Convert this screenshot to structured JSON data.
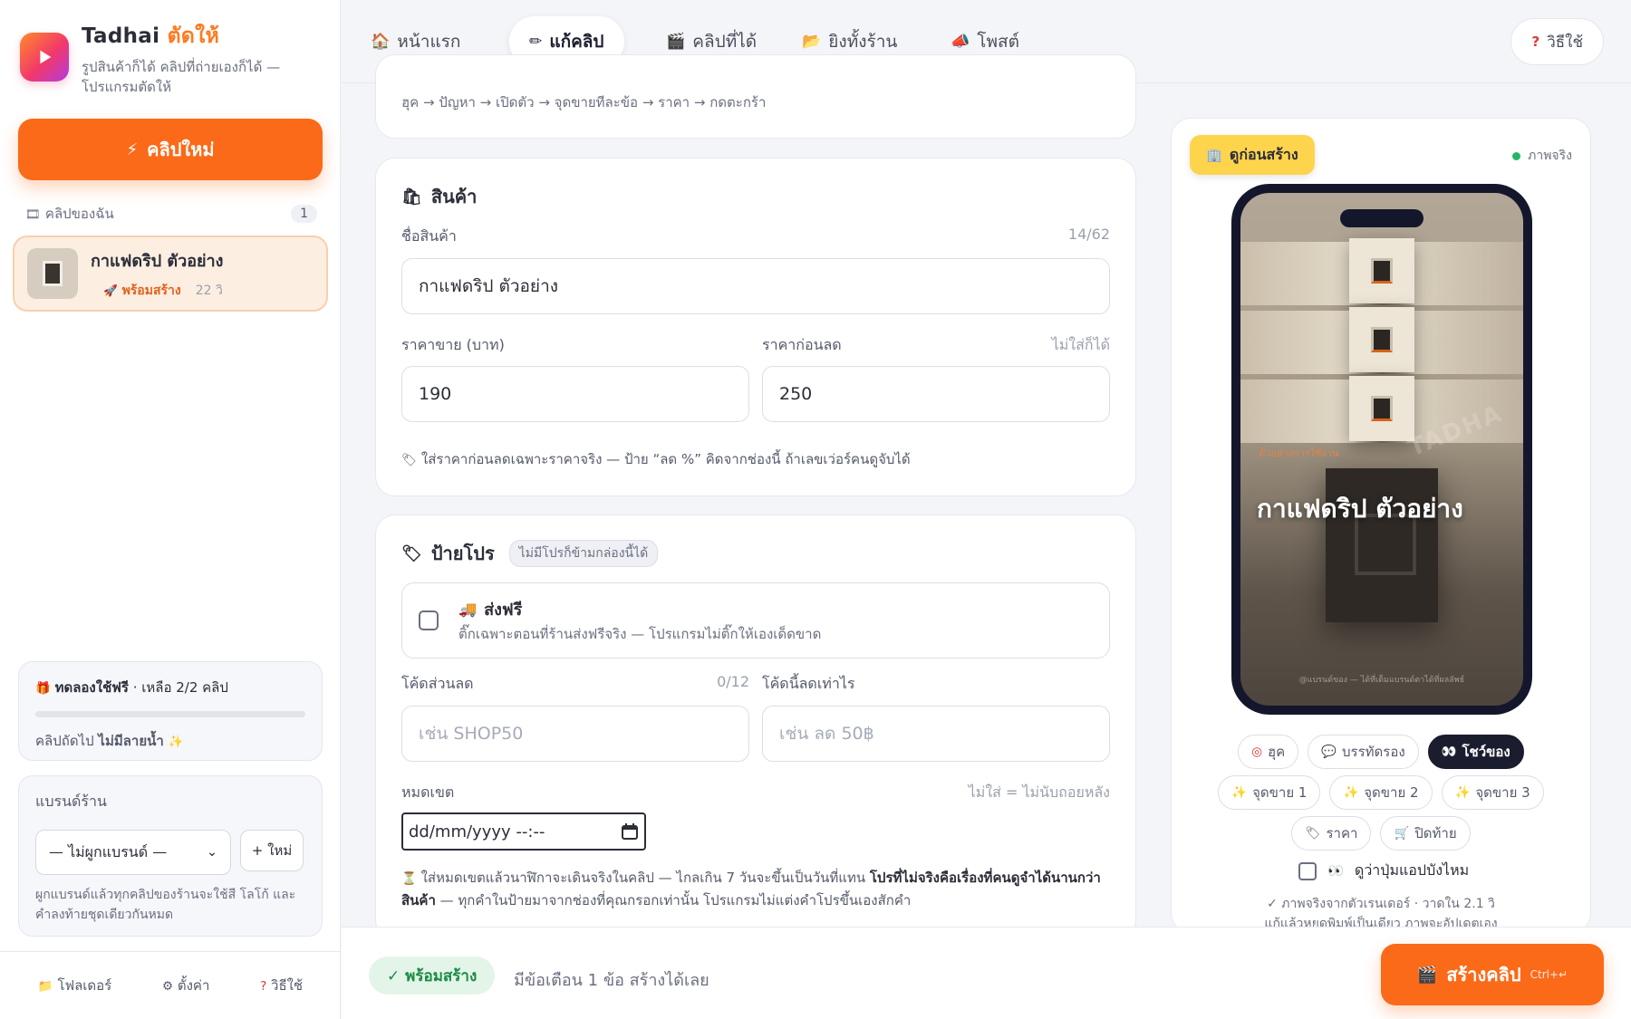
{
  "app": {
    "name_main": "Tadhai",
    "name_accent": "ตัดให้",
    "tagline": "รูปสินค้าก็ได้ คลิปที่ถ่ายเองก็ได้ — โปรแกรมตัดให้",
    "brand_gradient": [
      "#ff8a2a",
      "#f2386a",
      "#b13ce0"
    ]
  },
  "sidebar": {
    "new_clip_label": "คลิปใหม่",
    "clips_heading": "คลิปของฉัน",
    "clips_count": "1",
    "clips": [
      {
        "title": "กาแฟดริป ตัวอย่าง",
        "status": "พร้อมสร้าง",
        "duration": "22 วิ"
      }
    ],
    "trial": {
      "title": "ทดลองใช้ฟรี",
      "remaining": "· เหลือ 2/2 คลิป",
      "progress": 0,
      "note_prefix": "คลิปถัดไป",
      "note_bold": "ไม่มีลายน้ำ"
    },
    "brand": {
      "title": "แบรนด์ร้าน",
      "select_value": "— ไม่ผูกแบรนด์ —",
      "new_label": "+ ใหม่",
      "note": "ผูกแบรนด์แล้วทุกคลิปของร้านจะใช้สี โลโก้ และคำลงท้ายชุดเดียวกันหมด"
    },
    "footer": [
      {
        "icon": "folder-icon",
        "label": "โฟลเดอร์"
      },
      {
        "icon": "gear-icon",
        "label": "ตั้งค่า"
      },
      {
        "icon": "help-icon",
        "label": "วิธีใช้"
      }
    ]
  },
  "nav": {
    "tabs": [
      {
        "icon": "home-icon",
        "label": "หน้าแรก",
        "active": false
      },
      {
        "icon": "pencil-icon",
        "label": "แก้คลิป",
        "active": true
      },
      {
        "icon": "clapper-icon",
        "label": "คลิปที่ได้",
        "active": false
      },
      {
        "icon": "folder-icon",
        "label": "ยิงทั้งร้าน",
        "active": false
      },
      {
        "icon": "megaphone-icon",
        "label": "โพสต์",
        "active": false
      }
    ],
    "help_label": "วิธีใช้"
  },
  "editor": {
    "flow_text": "ฮุค → ปัญหา → เปิดตัว → จุดขายทีละข้อ → ราคา → กดตะกร้า",
    "product": {
      "title": "สินค้า",
      "name_label": "ชื่อสินค้า",
      "name_counter": "14/62",
      "name_value": "กาแฟดริป ตัวอย่าง",
      "price_label": "ราคาขาย (บาท)",
      "price_value": "190",
      "orig_label": "ราคาก่อนลด",
      "orig_optional": "ไม่ใส่ก็ได้",
      "orig_value": "250",
      "hint": "ใส่ราคาก่อนลดเฉพาะราคาจริง — ป้าย “ลด %” คิดจากช่องนี้ ถ้าเลขเว่อร์คนดูจับได้"
    },
    "promo": {
      "title": "ป้ายโปร",
      "chip": "ไม่มีโปรก็ข้ามกล่องนี้ได้",
      "free_ship_title": "ส่งฟรี",
      "free_ship_sub": "ติ๊กเฉพาะตอนที่ร้านส่งฟรีจริง — โปรแกรมไม่ติ๊กให้เองเด็ดขาด",
      "free_ship_checked": false,
      "code_label": "โค้ดส่วนลด",
      "code_counter": "0/12",
      "code_placeholder": "เช่น SHOP50",
      "discount_label": "โค้ดนี้ลดเท่าไร",
      "discount_placeholder": "เช่น ลด 50฿",
      "expiry_label": "หมดเขต",
      "expiry_optional": "ไม่ใส่ = ไม่นับถอยหลัง",
      "expiry_value": "dd/mm/yyyy --:--",
      "expiry_hint_a": "ใส่หมดเขตแล้วนาฬิกาจะเดินจริงในคลิป — ไกลเกิน 7 วันจะขึ้นเป็นวันที่แทน ",
      "expiry_hint_bold": "โปรที่ไม่จริงคือเรื่องที่คนดูจำได้นานกว่าสินค้า",
      "expiry_hint_b": " — ทุกคำในป้ายมาจากช่องที่คุณกรอกเท่านั้น โปรแกรมไม่แต่งคำโปรขึ้นเองสักคำ"
    }
  },
  "bottom": {
    "ready_label": "✓ พร้อมสร้าง",
    "warn_text": "มีข้อเตือน 1 ข้อ สร้างได้เลย",
    "create_label": "สร้างคลิป",
    "create_shortcut": "Ctrl+↵"
  },
  "preview": {
    "chip_label": "ดูก่อนสร้าง",
    "real_label": "ภาพจริง",
    "watermark": "TADHA",
    "example_tag": "ตัวอย่างการใช้งาน",
    "hero_title": "กาแฟดริป ตัวอย่าง",
    "footer_caption": "@แบรนด์ของ — ได้ที่เต็มแบรนด์ตาได้ที่ผลลัพธ์",
    "scenes": [
      {
        "icon": "target-icon",
        "label": "ฮุค",
        "active": false
      },
      {
        "icon": "speech-icon",
        "label": "บรรทัดรอง",
        "active": false
      },
      {
        "icon": "binoculars-icon",
        "label": "โชว์ของ",
        "active": true
      },
      {
        "icon": "sparkle-icon",
        "label": "จุดขาย 1",
        "active": false
      },
      {
        "icon": "sparkle-icon",
        "label": "จุดขาย 2",
        "active": false
      },
      {
        "icon": "sparkle-icon",
        "label": "จุดขาย 3",
        "active": false
      },
      {
        "icon": "tag-icon",
        "label": "ราคา",
        "active": false
      },
      {
        "icon": "cart-icon",
        "label": "ปิดท้าย",
        "active": false
      }
    ],
    "app_button_label": "ดูว่าปุ่มแอปบังไหม",
    "note_line1": "✓ ภาพจริงจากตัวเรนเดอร์ · วาดใน 2.1 วิ",
    "note_line2": "แก้แล้วหยุดพิมพ์เป็นเดียว ภาพจะอัปเดตเอง"
  },
  "colors": {
    "accent": "#fb6a18",
    "ready_green": "#1d8a45",
    "preview_chip": "#ffd44d",
    "active_scene": "#1a1d2e"
  }
}
